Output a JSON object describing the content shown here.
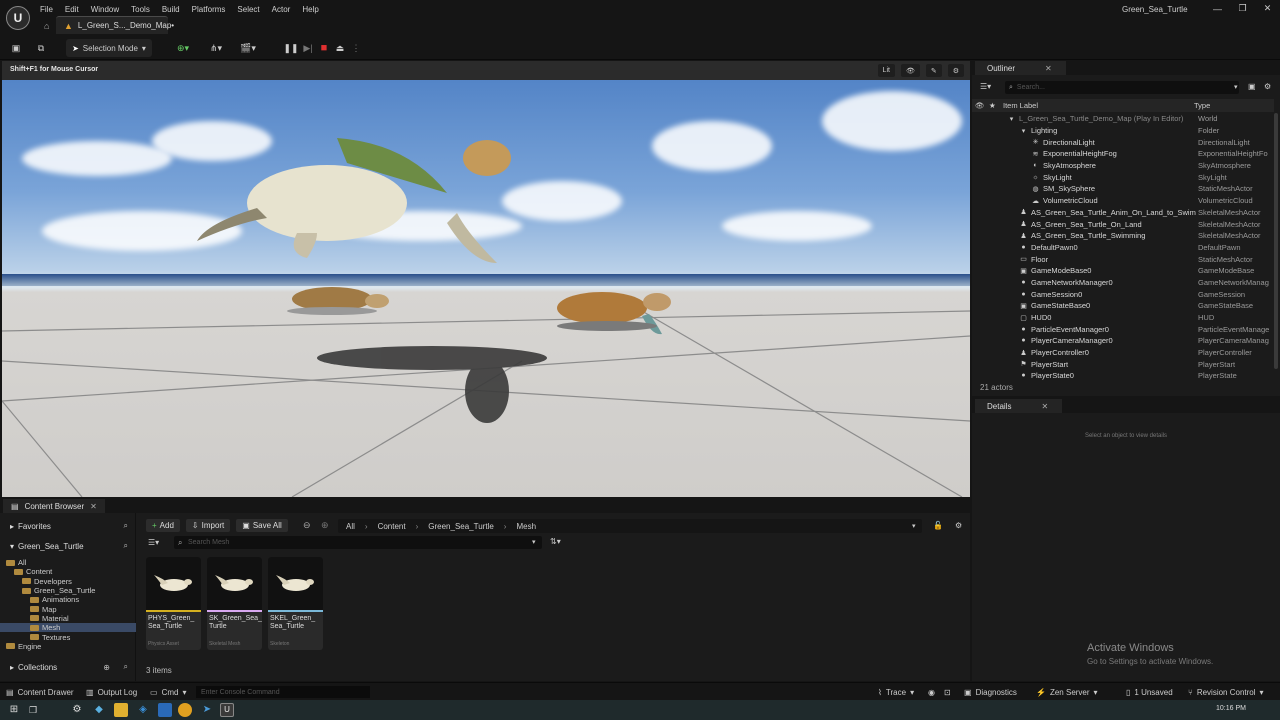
{
  "menubar": {
    "logo": "U",
    "items": [
      "File",
      "Edit",
      "Window",
      "Tools",
      "Build",
      "Platforms",
      "Select",
      "Actor",
      "Help"
    ],
    "map_tab": "L_Green_S..._Demo_Map•",
    "window_title": "Green_Sea_Turtle",
    "window_buttons": [
      "—",
      "❐",
      "✕"
    ]
  },
  "toolbar": {
    "selection_mode": "Selection Mode"
  },
  "viewport": {
    "hint": "Shift+F1 for Mouse Cursor",
    "controls": [
      "Lit",
      "👁",
      "✎",
      "⚙"
    ]
  },
  "outliner": {
    "title": "Outliner",
    "search_placeholder": "Search...",
    "col_label": "Item Label",
    "col_type": "Type",
    "rows": [
      {
        "label": "L_Green_Sea_Turtle_Demo_Map (Play In Editor)",
        "type": "World",
        "indent": 3,
        "icon": "▾"
      },
      {
        "label": "Lighting",
        "type": "Folder",
        "indent": 4,
        "icon": "▾"
      },
      {
        "label": "DirectionalLight",
        "type": "DirectionalLight",
        "indent": 5,
        "icon": "✳"
      },
      {
        "label": "ExponentialHeightFog",
        "type": "ExponentialHeightFo",
        "indent": 5,
        "icon": "≋"
      },
      {
        "label": "SkyAtmosphere",
        "type": "SkyAtmosphere",
        "indent": 5,
        "icon": "◐"
      },
      {
        "label": "SkyLight",
        "type": "SkyLight",
        "indent": 5,
        "icon": "☼"
      },
      {
        "label": "SM_SkySphere",
        "type": "StaticMeshActor",
        "indent": 5,
        "icon": "◍"
      },
      {
        "label": "VolumetricCloud",
        "type": "VolumetricCloud",
        "indent": 5,
        "icon": "☁"
      },
      {
        "label": "AS_Green_Sea_Turtle_Anim_On_Land_to_Swim",
        "type": "SkeletalMeshActor",
        "indent": 4,
        "icon": "♟"
      },
      {
        "label": "AS_Green_Sea_Turtle_On_Land",
        "type": "SkeletalMeshActor",
        "indent": 4,
        "icon": "♟"
      },
      {
        "label": "AS_Green_Sea_Turtle_Swimming",
        "type": "SkeletalMeshActor",
        "indent": 4,
        "icon": "♟"
      },
      {
        "label": "DefaultPawn0",
        "type": "DefaultPawn",
        "indent": 4,
        "icon": "●"
      },
      {
        "label": "Floor",
        "type": "StaticMeshActor",
        "indent": 4,
        "icon": "▭"
      },
      {
        "label": "GameModeBase0",
        "type": "GameModeBase",
        "indent": 4,
        "icon": "▣"
      },
      {
        "label": "GameNetworkManager0",
        "type": "GameNetworkManag",
        "indent": 4,
        "icon": "●"
      },
      {
        "label": "GameSession0",
        "type": "GameSession",
        "indent": 4,
        "icon": "●"
      },
      {
        "label": "GameStateBase0",
        "type": "GameStateBase",
        "indent": 4,
        "icon": "▣"
      },
      {
        "label": "HUD0",
        "type": "HUD",
        "indent": 4,
        "icon": "▢"
      },
      {
        "label": "ParticleEventManager0",
        "type": "ParticleEventManage",
        "indent": 4,
        "icon": "●"
      },
      {
        "label": "PlayerCameraManager0",
        "type": "PlayerCameraManag",
        "indent": 4,
        "icon": "●"
      },
      {
        "label": "PlayerController0",
        "type": "PlayerController",
        "indent": 4,
        "icon": "♟"
      },
      {
        "label": "PlayerStart",
        "type": "PlayerStart",
        "indent": 4,
        "icon": "⚑"
      },
      {
        "label": "PlayerState0",
        "type": "PlayerState",
        "indent": 4,
        "icon": "●"
      }
    ],
    "count": "21 actors"
  },
  "details": {
    "title": "Details",
    "empty_message": "Select an object to view details"
  },
  "watermark": {
    "line1": "Activate Windows",
    "line2": "Go to Settings to activate Windows."
  },
  "content_browser": {
    "title": "Content Browser",
    "favorites": "Favorites",
    "project": "Green_Sea_Turtle",
    "collections": "Collections",
    "tree": [
      {
        "label": "All",
        "indent": 1,
        "selected": false
      },
      {
        "label": "Content",
        "indent": 2,
        "selected": false
      },
      {
        "label": "Developers",
        "indent": 3,
        "selected": false
      },
      {
        "label": "Green_Sea_Turtle",
        "indent": 3,
        "selected": true
      },
      {
        "label": "Animations",
        "indent": 4,
        "selected": false
      },
      {
        "label": "Map",
        "indent": 4,
        "selected": false
      },
      {
        "label": "Material",
        "indent": 4,
        "selected": false
      },
      {
        "label": "Mesh",
        "indent": 4,
        "selected": true
      },
      {
        "label": "Textures",
        "indent": 4,
        "selected": false
      },
      {
        "label": "Engine",
        "indent": 1,
        "selected": false
      }
    ],
    "add": "Add",
    "import": "Import",
    "save_all": "Save All",
    "breadcrumb": [
      "All",
      "Content",
      "Green_Sea_Turtle",
      "Mesh"
    ],
    "search_placeholder": "Search Mesh",
    "assets": [
      {
        "name": "PHYS_Green_ Sea_Turtle",
        "type": "Physics Asset",
        "color": "#d4b020"
      },
      {
        "name": "SK_Green_Sea_ Turtle",
        "type": "Skeletal Mesh",
        "color": "#d8a8f0"
      },
      {
        "name": "SKEL_Green_ Sea_Turtle",
        "type": "Skeleton",
        "color": "#7ab8d8"
      }
    ],
    "item_count": "3 items"
  },
  "statusbar": {
    "content_drawer": "Content Drawer",
    "output_log": "Output Log",
    "cmd": "Cmd",
    "console_placeholder": "Enter Console Command",
    "trace": "Trace",
    "diagnostics": "Diagnostics",
    "zen_server": "Zen Server",
    "unsaved": "1 Unsaved",
    "revision_control": "Revision Control"
  },
  "taskbar": {
    "time": "10:16 PM"
  }
}
